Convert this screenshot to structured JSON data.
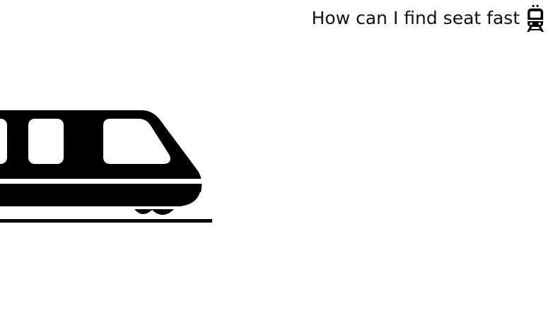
{
  "header": {
    "title": "How can I find seat fast",
    "icon": "train-front-icon"
  },
  "illustration": {
    "icon": "train-side-icon"
  },
  "colors": {
    "background": "#ffffff",
    "ink": "#000000"
  }
}
